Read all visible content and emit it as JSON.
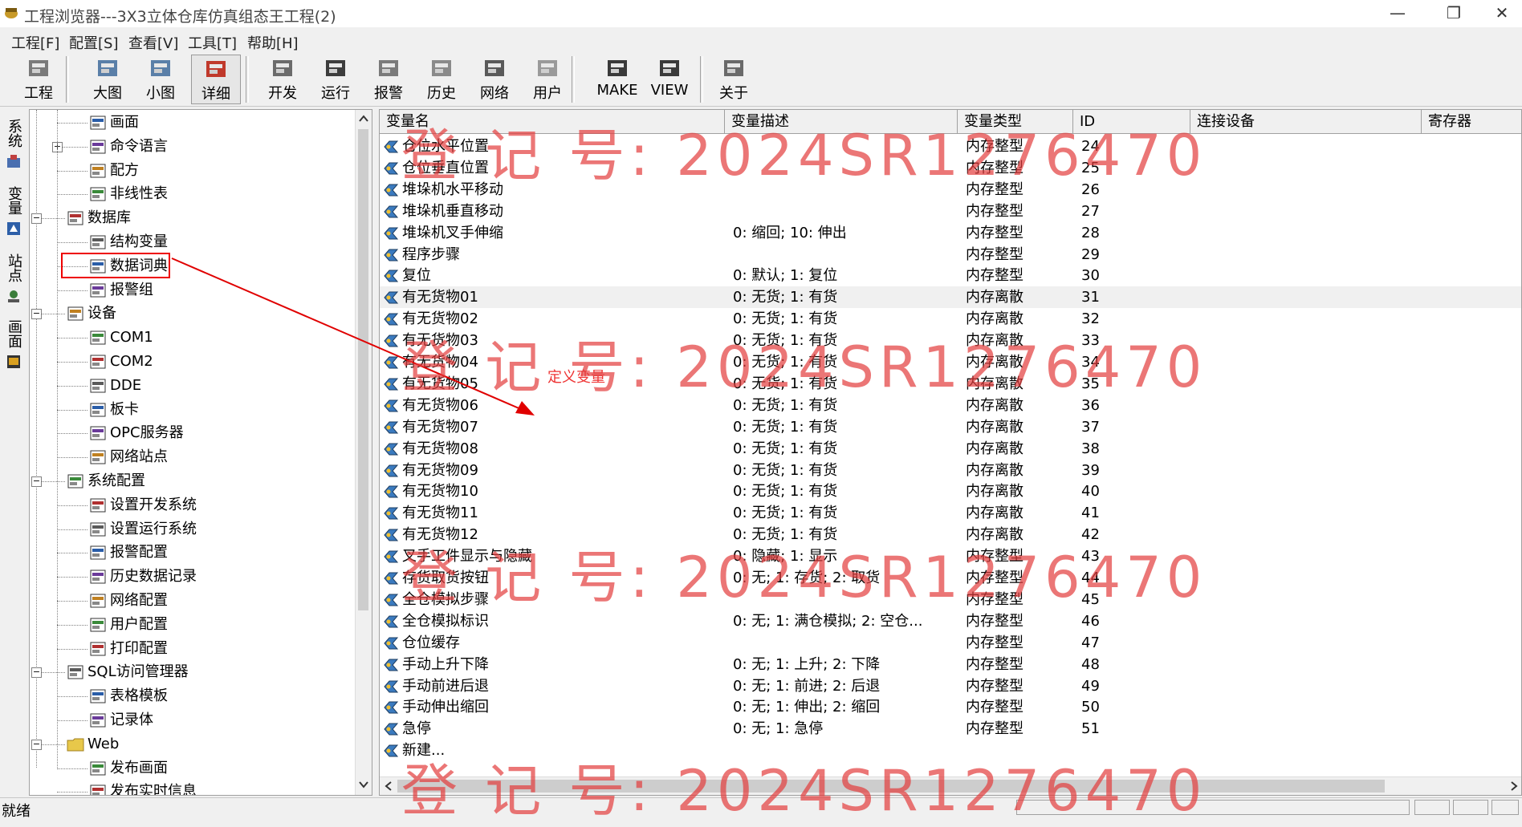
{
  "window": {
    "title": "工程浏览器---3X3立体仓库仿真组态王工程(2)",
    "minimize": "—",
    "restore": "❐",
    "close": "✕"
  },
  "menu": [
    {
      "label": "工程[F]"
    },
    {
      "label": "配置[S]"
    },
    {
      "label": "查看[V]"
    },
    {
      "label": "工具[T]"
    },
    {
      "label": "帮助[H]"
    }
  ],
  "toolbar": [
    {
      "label": "工程",
      "icon": "project-icon"
    },
    {
      "label": "大图",
      "icon": "large-icons-icon"
    },
    {
      "label": "小图",
      "icon": "small-icons-icon"
    },
    {
      "label": "详细",
      "icon": "details-icon",
      "active": true
    },
    {
      "label": "开发",
      "icon": "develop-icon"
    },
    {
      "label": "运行",
      "icon": "run-icon"
    },
    {
      "label": "报警",
      "icon": "alarm-icon"
    },
    {
      "label": "历史",
      "icon": "history-icon"
    },
    {
      "label": "网络",
      "icon": "network-icon"
    },
    {
      "label": "用户",
      "icon": "user-key-icon"
    },
    {
      "label": "MAKE",
      "icon": "make-icon"
    },
    {
      "label": "VIEW",
      "icon": "view-icon"
    },
    {
      "label": "关于",
      "icon": "about-icon"
    }
  ],
  "side_tabs": [
    "系统",
    "变量",
    "站点",
    "画面"
  ],
  "tree": [
    {
      "label": "画面",
      "level": 2,
      "icon": "screen-icon"
    },
    {
      "label": "命令语言",
      "level": 2,
      "icon": "command-icon",
      "expander": "+"
    },
    {
      "label": "配方",
      "level": 2,
      "icon": "recipe-icon"
    },
    {
      "label": "非线性表",
      "level": 2,
      "icon": "nonlinear-icon"
    },
    {
      "label": "数据库",
      "level": 1,
      "icon": "database-icon",
      "expander": "−"
    },
    {
      "label": "结构变量",
      "level": 2,
      "icon": "struct-icon"
    },
    {
      "label": "数据词典",
      "level": 2,
      "icon": "dictionary-icon"
    },
    {
      "label": "报警组",
      "level": 2,
      "icon": "alarm-group-icon"
    },
    {
      "label": "设备",
      "level": 1,
      "icon": "device-icon",
      "expander": "−"
    },
    {
      "label": "COM1",
      "level": 2,
      "icon": "com-port-icon"
    },
    {
      "label": "COM2",
      "level": 2,
      "icon": "com-port-icon"
    },
    {
      "label": "DDE",
      "level": 2,
      "icon": "dde-icon"
    },
    {
      "label": "板卡",
      "level": 2,
      "icon": "card-icon"
    },
    {
      "label": "OPC服务器",
      "level": 2,
      "icon": "opc-icon"
    },
    {
      "label": "网络站点",
      "level": 2,
      "icon": "network-site-icon"
    },
    {
      "label": "系统配置",
      "level": 1,
      "icon": "tools-icon",
      "expander": "−"
    },
    {
      "label": "设置开发系统",
      "level": 2,
      "icon": "dev-setting-icon"
    },
    {
      "label": "设置运行系统",
      "level": 2,
      "icon": "run-setting-icon"
    },
    {
      "label": "报警配置",
      "level": 2,
      "icon": "alarm-config-icon"
    },
    {
      "label": "历史数据记录",
      "level": 2,
      "icon": "history-record-icon"
    },
    {
      "label": "网络配置",
      "level": 2,
      "icon": "network-config-icon"
    },
    {
      "label": "用户配置",
      "level": 2,
      "icon": "user-config-icon"
    },
    {
      "label": "打印配置",
      "level": 2,
      "icon": "print-icon"
    },
    {
      "label": "SQL访问管理器",
      "level": 1,
      "icon": "sql-icon",
      "expander": "−"
    },
    {
      "label": "表格模板",
      "level": 2,
      "icon": "table-template-icon"
    },
    {
      "label": "记录体",
      "level": 2,
      "icon": "record-icon"
    },
    {
      "label": "Web",
      "level": 1,
      "icon": "folder-icon",
      "expander": "−"
    },
    {
      "label": "发布画面",
      "level": 2,
      "icon": "publish-icon"
    },
    {
      "label": "发布实时信息",
      "level": 2,
      "icon": "publish-info-icon"
    }
  ],
  "columns": [
    "变量名",
    "变量描述",
    "变量类型",
    "ID",
    "连接设备",
    "寄存器"
  ],
  "rows": [
    {
      "name": "仓位水平位置",
      "desc": "",
      "type": "内存整型",
      "id": "24"
    },
    {
      "name": "仓位垂直位置",
      "desc": "",
      "type": "内存整型",
      "id": "25"
    },
    {
      "name": "堆垛机水平移动",
      "desc": "",
      "type": "内存整型",
      "id": "26"
    },
    {
      "name": "堆垛机垂直移动",
      "desc": "",
      "type": "内存整型",
      "id": "27"
    },
    {
      "name": "堆垛机叉手伸缩",
      "desc": "0: 缩回; 10: 伸出",
      "type": "内存整型",
      "id": "28"
    },
    {
      "name": "程序步骤",
      "desc": "",
      "type": "内存整型",
      "id": "29"
    },
    {
      "name": "复位",
      "desc": "0: 默认; 1: 复位",
      "type": "内存整型",
      "id": "30"
    },
    {
      "name": "有无货物01",
      "desc": "0: 无货; 1: 有货",
      "type": "内存离散",
      "id": "31",
      "selected": true
    },
    {
      "name": "有无货物02",
      "desc": "0: 无货; 1: 有货",
      "type": "内存离散",
      "id": "32"
    },
    {
      "name": "有无货物03",
      "desc": "0: 无货; 1: 有货",
      "type": "内存离散",
      "id": "33"
    },
    {
      "name": "有无货物04",
      "desc": "0: 无货; 1: 有货",
      "type": "内存离散",
      "id": "34"
    },
    {
      "name": "有无货物05",
      "desc": "0: 无货; 1: 有货",
      "type": "内存离散",
      "id": "35"
    },
    {
      "name": "有无货物06",
      "desc": "0: 无货; 1: 有货",
      "type": "内存离散",
      "id": "36"
    },
    {
      "name": "有无货物07",
      "desc": "0: 无货; 1: 有货",
      "type": "内存离散",
      "id": "37"
    },
    {
      "name": "有无货物08",
      "desc": "0: 无货; 1: 有货",
      "type": "内存离散",
      "id": "38"
    },
    {
      "name": "有无货物09",
      "desc": "0: 无货; 1: 有货",
      "type": "内存离散",
      "id": "39"
    },
    {
      "name": "有无货物10",
      "desc": "0: 无货; 1: 有货",
      "type": "内存离散",
      "id": "40"
    },
    {
      "name": "有无货物11",
      "desc": "0: 无货; 1: 有货",
      "type": "内存离散",
      "id": "41"
    },
    {
      "name": "有无货物12",
      "desc": "0: 无货; 1: 有货",
      "type": "内存离散",
      "id": "42"
    },
    {
      "name": "叉手工件显示与隐藏",
      "desc": "0: 隐藏; 1: 显示",
      "type": "内存整型",
      "id": "43"
    },
    {
      "name": "存货取货按钮",
      "desc": "0: 无; 1: 存货; 2: 取货",
      "type": "内存整型",
      "id": "44"
    },
    {
      "name": "全仓模拟步骤",
      "desc": "",
      "type": "内存整型",
      "id": "45"
    },
    {
      "name": "全仓模拟标识",
      "desc": "0: 无; 1: 满仓模拟; 2: 空仓...",
      "type": "内存整型",
      "id": "46"
    },
    {
      "name": "仓位缓存",
      "desc": "",
      "type": "内存整型",
      "id": "47"
    },
    {
      "name": "手动上升下降",
      "desc": "0: 无; 1: 上升; 2: 下降",
      "type": "内存整型",
      "id": "48"
    },
    {
      "name": "手动前进后退",
      "desc": "0: 无; 1: 前进; 2: 后退",
      "type": "内存整型",
      "id": "49"
    },
    {
      "name": "手动伸出缩回",
      "desc": "0: 无; 1: 伸出; 2: 缩回",
      "type": "内存整型",
      "id": "50"
    },
    {
      "name": "急停",
      "desc": "0: 无; 1: 急停",
      "type": "内存整型",
      "id": "51"
    },
    {
      "name": "新建...",
      "desc": "",
      "type": "",
      "id": ""
    }
  ],
  "status": {
    "text": "就绪"
  },
  "annotation": {
    "text": "定义变量"
  },
  "watermark": {
    "text": "登 记 号:  2024SR1276470"
  },
  "colors": {
    "annotation": "#e00000",
    "watermark": "#e23c3c"
  }
}
